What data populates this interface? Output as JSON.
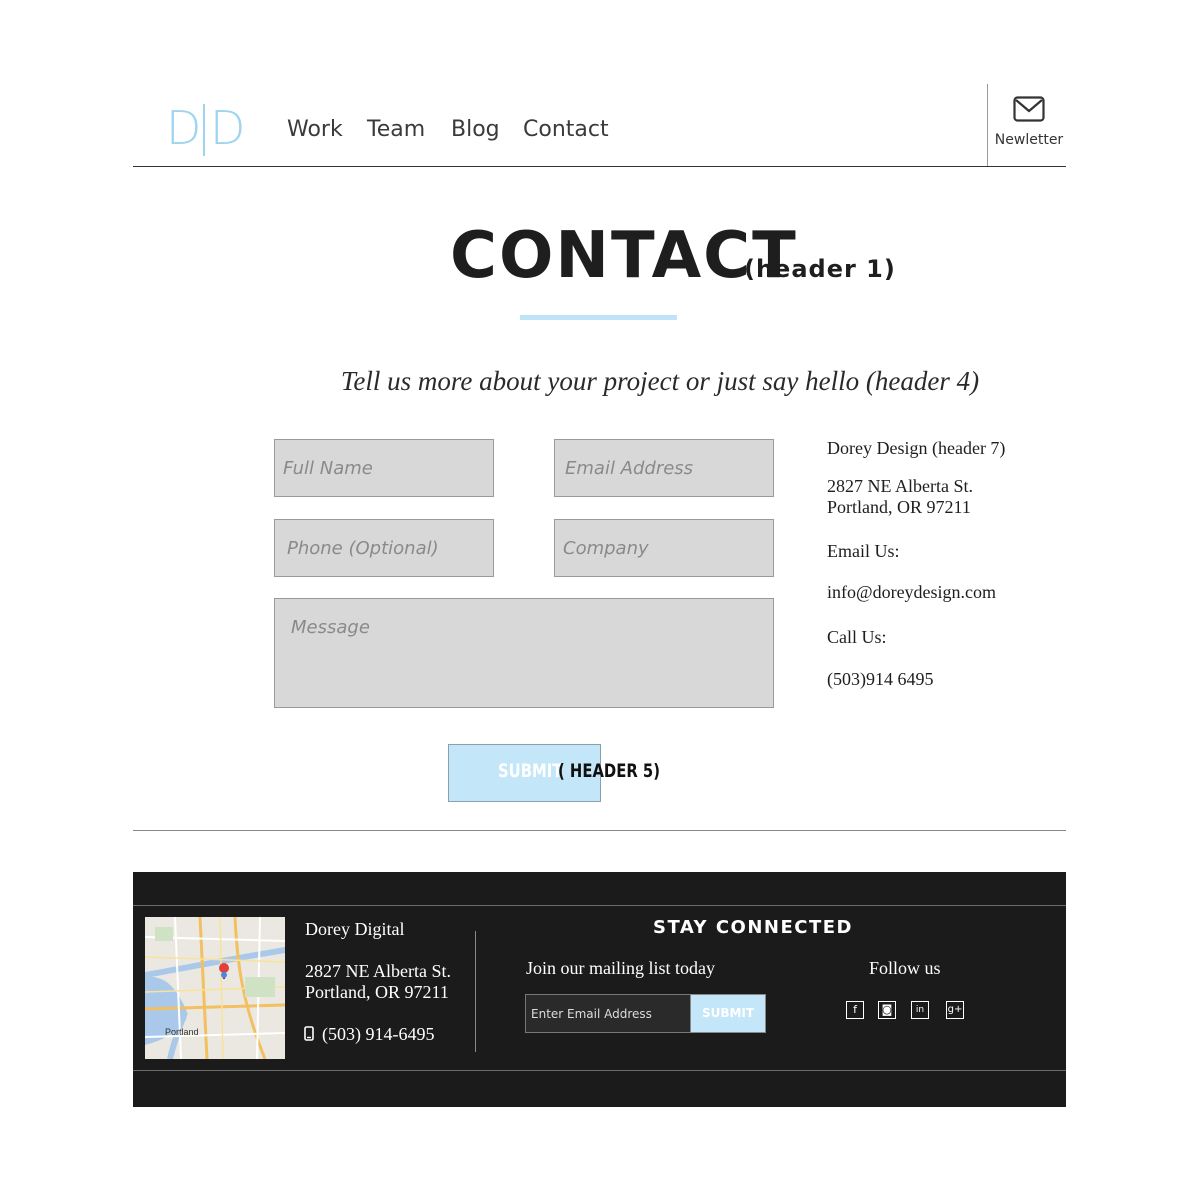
{
  "header": {
    "logo": {
      "left": "D",
      "right": "D"
    },
    "nav": [
      "Work",
      "Team",
      "Blog",
      "Contact"
    ],
    "newsletter_label": "Newletter"
  },
  "main": {
    "title": "CONTACT",
    "title_note": "(header 1)",
    "subtitle": "Tell us more about your project or just say hello (header 4)",
    "form": {
      "full_name_placeholder": "Full Name",
      "email_placeholder": "Email Address",
      "phone_placeholder": "Phone (Optional)",
      "company_placeholder": "Company",
      "message_placeholder": "Message",
      "submit_label": "SUBMIT",
      "submit_note": "( HEADER 5)"
    },
    "contact_info": {
      "company": "Dorey Design (header 7)",
      "address_line1": "2827 NE Alberta St.",
      "address_line2": "Portland, OR 97211",
      "email_heading": "Email Us:",
      "email": "info@doreydesign.com",
      "call_heading": "Call Us:",
      "phone": "(503)914 6495"
    }
  },
  "footer": {
    "map_label": "Portland",
    "company": "Dorey Digital",
    "address_line1": "2827 NE Alberta St.",
    "address_line2": "Portland, OR 97211",
    "phone": "(503) 914-6495",
    "heading": "STAY CONNECTED",
    "mailing_text": "Join our mailing list today",
    "email_placeholder": "Enter Email Address",
    "submit_label": "SUBMIT",
    "follow_text": "Follow us",
    "social": [
      {
        "icon": "facebook-icon",
        "glyph": "f"
      },
      {
        "icon": "instagram-icon",
        "glyph": "◙"
      },
      {
        "icon": "linkedin-icon",
        "glyph": "in"
      },
      {
        "icon": "google-plus-icon",
        "glyph": "g+"
      }
    ]
  },
  "colors": {
    "accent": "#9fd4ef",
    "button": "#c4e6f9",
    "field_bg": "#d8d8d8",
    "footer_bg": "#1b1b1b"
  }
}
